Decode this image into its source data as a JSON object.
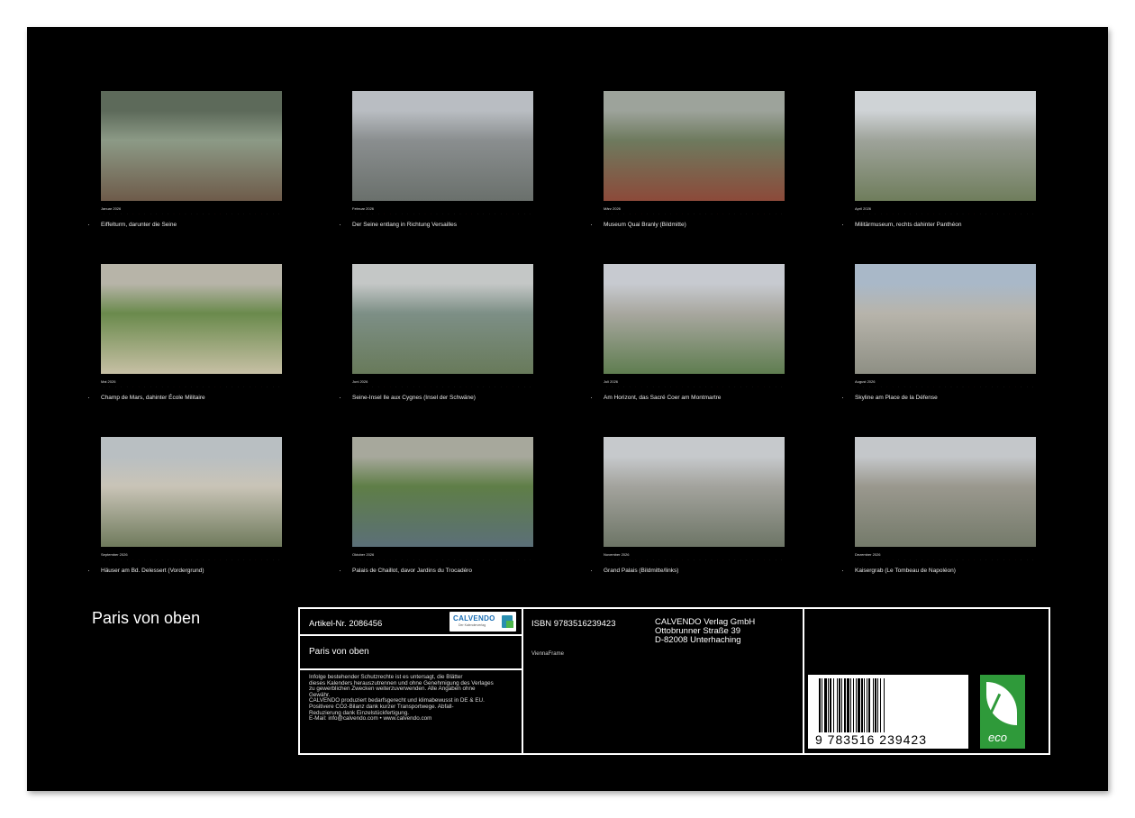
{
  "calendar": {
    "title": "Paris von oben",
    "months": [
      {
        "month": "Januar 2026",
        "caption": "Eiffelturm, darunter die Seine",
        "tone": [
          "#5d6a5a",
          "#8c9a86",
          "#6e5b4a"
        ]
      },
      {
        "month": "Februar 2026",
        "caption": "Der Seine entlang in Richtung Versailles",
        "tone": [
          "#b9bdc2",
          "#8a8e8f",
          "#6a706c"
        ]
      },
      {
        "month": "März 2026",
        "caption": "Museum Quai Branly (Bildmitte)",
        "tone": [
          "#9da39b",
          "#6e7a5e",
          "#8c4a3a"
        ]
      },
      {
        "month": "April 2026",
        "caption": "Militärmuseum, rechts dahinter Panthéon",
        "tone": [
          "#cfd3d6",
          "#9ea39a",
          "#6f7d5c"
        ]
      },
      {
        "month": "Mai 2026",
        "caption": "Champ de Mars, dahinter École Militaire",
        "tone": [
          "#b7b4a8",
          "#6a8a4c",
          "#c7c0a5"
        ]
      },
      {
        "month": "Juni 2026",
        "caption": "Seine-Insel Ile aux Cygnes (Insel der Schwäne)",
        "tone": [
          "#c4c7c6",
          "#7d8f86",
          "#687a5a"
        ]
      },
      {
        "month": "Juli 2026",
        "caption": "Am Horizont, das Sacré Coer am Montmartre",
        "tone": [
          "#c7cad0",
          "#a8a79f",
          "#5f7d50"
        ]
      },
      {
        "month": "August 2026",
        "caption": "Skyline am Place de la Défense",
        "tone": [
          "#a9b8c8",
          "#b7b4ab",
          "#8e8f84"
        ]
      },
      {
        "month": "September 2026",
        "caption": "Häuser am Bd. Delessert (Vordergrund)",
        "tone": [
          "#b9bfc2",
          "#c9c4b7",
          "#6f7a5c"
        ]
      },
      {
        "month": "Oktober 2026",
        "caption": "Palais de Chaillot, davor Jardins du Trocadéro",
        "tone": [
          "#a7a89c",
          "#5f7e47",
          "#5b6f78"
        ]
      },
      {
        "month": "November 2026",
        "caption": "Grand Palais (Bildmitte/links)",
        "tone": [
          "#c6c9cc",
          "#a3a39d",
          "#6d7566"
        ]
      },
      {
        "month": "Dezember 2026",
        "caption": "Kaisergrab (Le Tombeau de Napoléon)",
        "tone": [
          "#c4c7ca",
          "#9a988e",
          "#747a6a"
        ]
      }
    ]
  },
  "info": {
    "article": "Artikel-Nr. 2086456",
    "logo_name": "CALVENDO",
    "logo_sub": "Der Kalenderverlag",
    "product_title": "Paris von oben",
    "legal_lines": [
      "Infolge bestehender Schutzrechte ist es untersagt, die Blätter",
      "dieses Kalenders herauszutrennen und ohne Genehmigung des Verlages",
      "zu gewerblichen Zwecken weiterzuverwenden. Alle Angaben ohne",
      "Gewähr.",
      "CALVENDO produziert bedarfsgerecht und klimabewusst in DE & EU.",
      "Positivere CO2-Bilanz dank kurzer Transportwege. Abfall-",
      "Reduzierung dank Einzelstückfertigung.",
      "E-Mail: info@calvendo.com • www.calvendo.com"
    ],
    "isbn": "ISBN 9783516239423",
    "publisher_lines": [
      "CALVENDO Verlag GmbH",
      "Ottobrunner Straße 39",
      "D-82008 Unterhaching"
    ],
    "frame": "ViennaFrame",
    "barcode_number": "9 783516 239423",
    "eco_label": "eco"
  }
}
